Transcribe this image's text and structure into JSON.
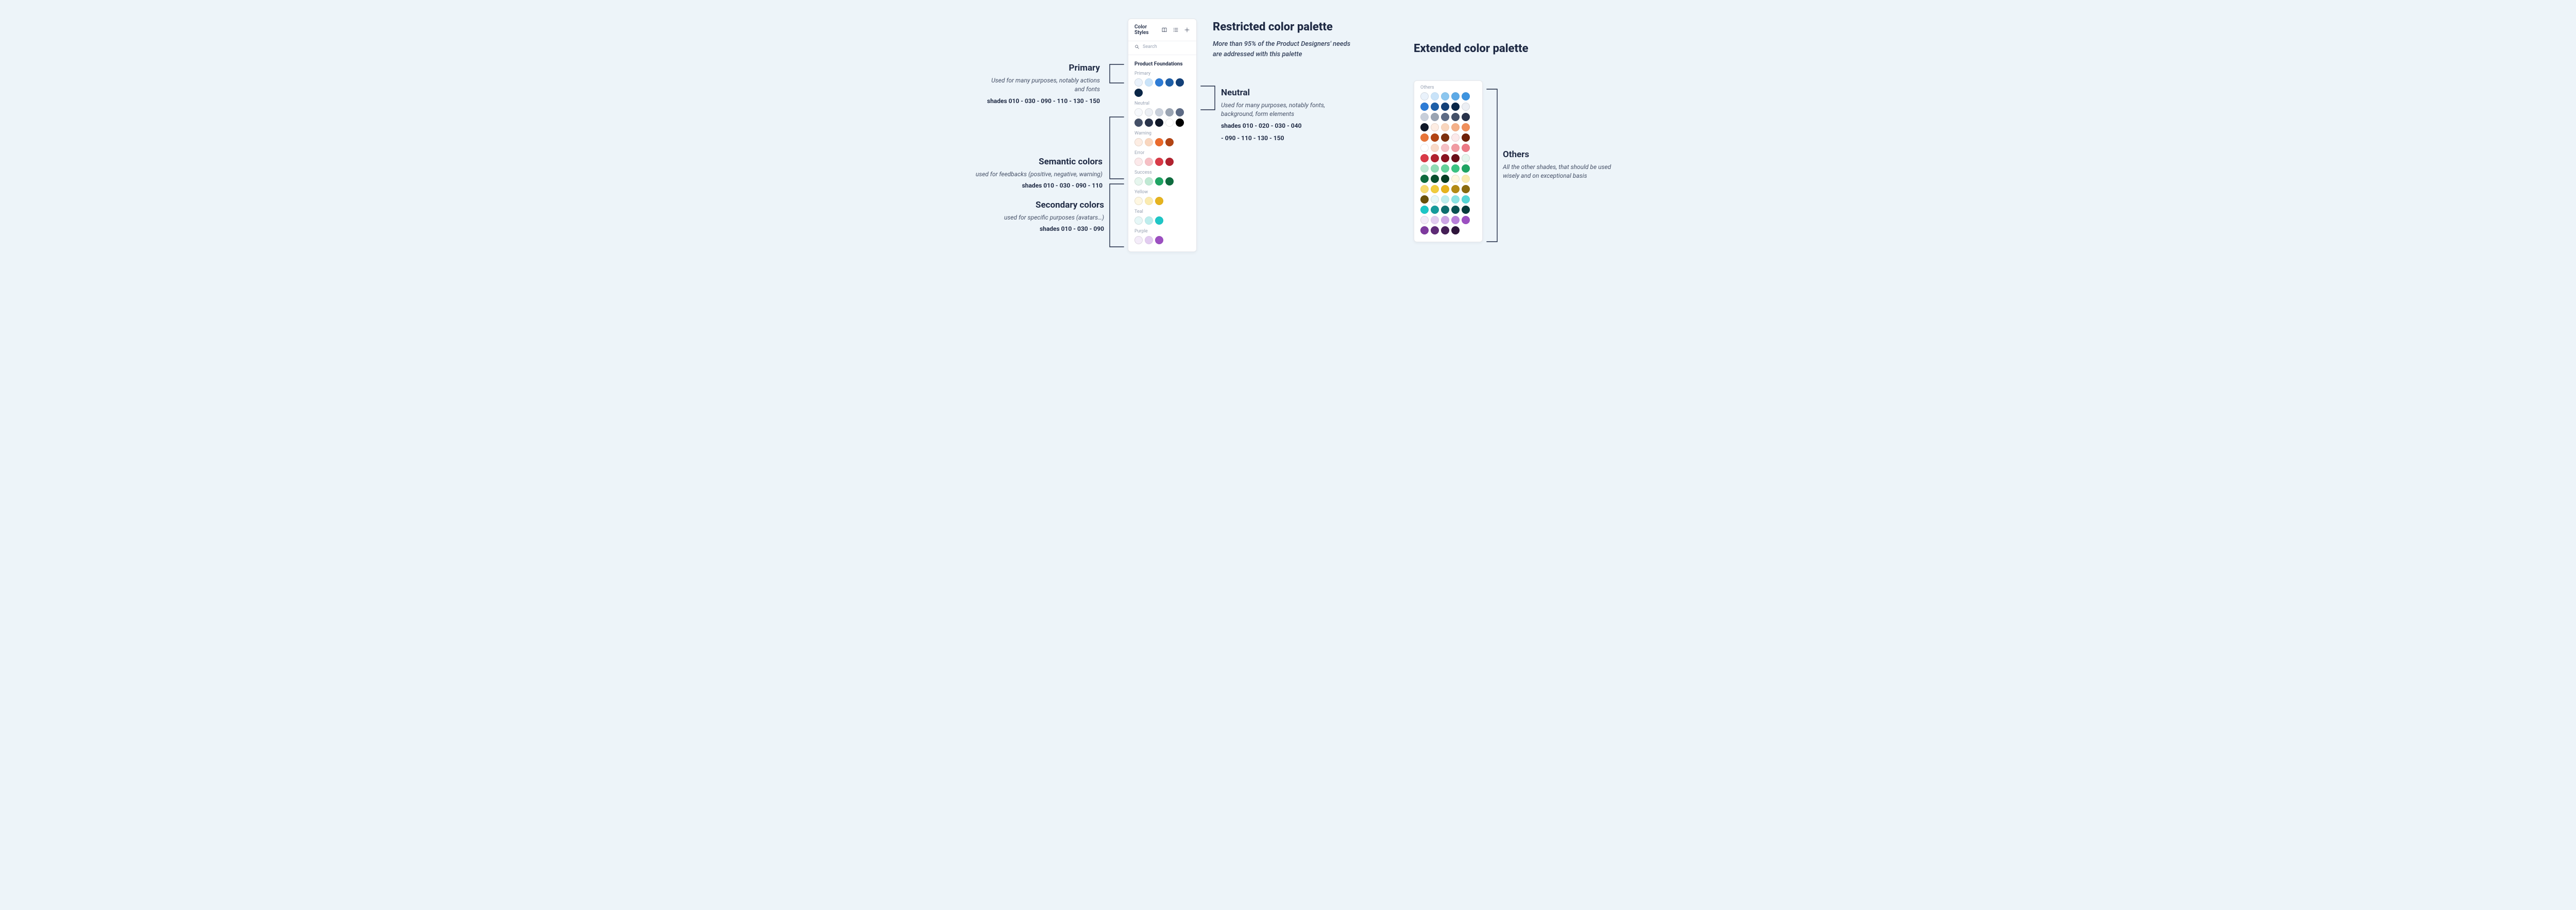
{
  "restricted": {
    "title": "Restricted color palette",
    "subtitle": "More than 95% of the Product Designers' needs are addressed with this palette"
  },
  "extended": {
    "title": "Extended color palette"
  },
  "panel": {
    "title": "Color Styles",
    "search_placeholder": "Search",
    "section": "Product Foundations",
    "groups": {
      "primary": "Primary",
      "neutral": "Neutral",
      "warning": "Warning",
      "error": "Error",
      "success": "Success",
      "yellow": "Yellow",
      "teal": "Teal",
      "purple": "Purple"
    }
  },
  "panel_ext": {
    "group": "Others"
  },
  "annot": {
    "primary": {
      "label": "Primary",
      "desc": "Used for many purposes, notably actions and fonts",
      "shades": "shades 010 - 030 - 090 - 110 - 130 - 150"
    },
    "neutral": {
      "label": "Neutral",
      "desc": "Used for many purposes, notably fonts, background, form elements",
      "shades_a": "shades 010 - 020 - 030 - 040",
      "shades_b": "- 090 - 110 - 130 - 150"
    },
    "semantic": {
      "label": "Semantic colors",
      "desc": "used for feedbacks (positive, negative, warning)",
      "shades": "shades 010 - 030 - 090 - 110"
    },
    "secondary": {
      "label": "Secondary colors",
      "desc": "used for specific purposes (avatars…)",
      "shades": "shades 010 - 030 - 090"
    },
    "others": {
      "label": "Others",
      "desc": "All the other shades, that should be used wisely and on exceptional basis"
    }
  },
  "swatches": {
    "primary": [
      "#EAF2FB",
      "#C9E3F9",
      "#2E7CD6",
      "#1E5FA8",
      "#134078",
      "#0A2647"
    ],
    "neutral": [
      "#F7F9FC",
      "#ECEFF4",
      "#C8CFDA",
      "#9AA4B2",
      "#5D6B85",
      "#445067",
      "#29334A",
      "#101828",
      "#FFFFFF",
      "#000000"
    ],
    "warning": [
      "#FDEDE3",
      "#F9D6BE",
      "#EA6A2B",
      "#B24414"
    ],
    "error": [
      "#FCE9EA",
      "#F6BFC4",
      "#D93A47",
      "#B1222F"
    ],
    "success": [
      "#E6F6EE",
      "#BFE9D3",
      "#1FA463",
      "#0E6B3E"
    ],
    "yellow": [
      "#FEF7E1",
      "#FBEBAF",
      "#E6B31E"
    ],
    "teal": [
      "#E6F7F7",
      "#BDEDED",
      "#1EC6C6"
    ],
    "purple": [
      "#F4ECF9",
      "#E2CCF0",
      "#9C4FC1"
    ],
    "others": [
      "#EAF2FB",
      "#C9E3F9",
      "#8CC6EF",
      "#5CA9E6",
      "#3E94DF",
      "#2E7CD6",
      "#1E5FA8",
      "#134078",
      "#0A2647",
      "#ECEFF4",
      "#C8CFDA",
      "#9AA4B2",
      "#5D6B85",
      "#445067",
      "#29334A",
      "#101828",
      "#FDEDE3",
      "#F9D6BE",
      "#F4B089",
      "#EF8E5A",
      "#E87539",
      "#B24414",
      "#7E300E",
      "#FCE9EA",
      "#6E2109",
      "#FFFFFF",
      "#F9D9C8",
      "#F6BFC4",
      "#F19AA2",
      "#EC7985",
      "#D93A47",
      "#B1222F",
      "#8A1220",
      "#6A0E19",
      "#E6F6EE",
      "#BFE9D3",
      "#8FDCB4",
      "#63D19A",
      "#3BC382",
      "#1FA463",
      "#0E6B3E",
      "#0A4F2D",
      "#073C22",
      "#FEF7E1",
      "#FBEBAF",
      "#F6DA6E",
      "#F0CC3D",
      "#E6B31E",
      "#B38A14",
      "#8A6A0E",
      "#6A5109",
      "#E6F7F7",
      "#BDEDED",
      "#8BE3E3",
      "#57D6D6",
      "#1EC6C6",
      "#169B9B",
      "#0E6E6E",
      "#0A5252",
      "#073C3C",
      "#F4ECF9",
      "#E2CCF0",
      "#CDA5E5",
      "#B97FDA",
      "#9C4FC1",
      "#7E3A9E",
      "#5E2B76",
      "#451F56",
      "#2F153B"
    ]
  }
}
